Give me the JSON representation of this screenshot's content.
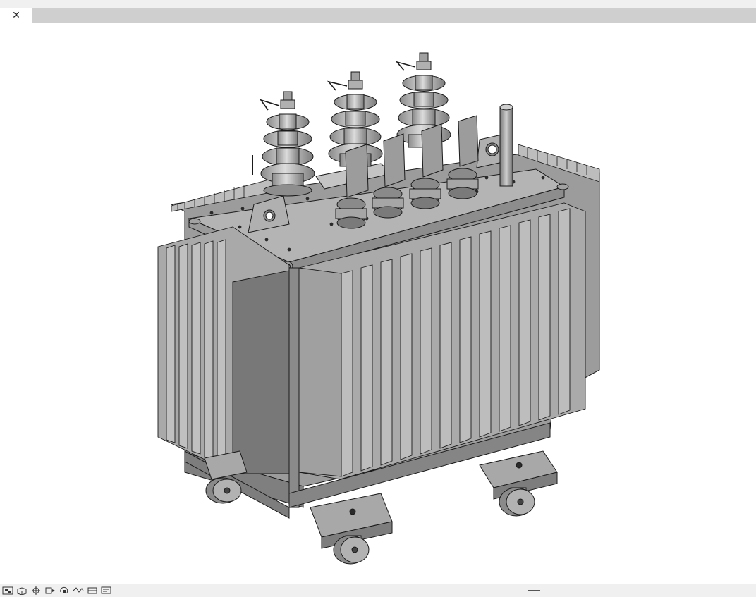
{
  "window": {
    "tab": {
      "close_glyph": "✕"
    }
  },
  "model": {
    "name": "oil-immersed-transformer",
    "colors": {
      "body": "#9a9a9a",
      "fins": "#a8a8a8",
      "dark": "#6f6f6f",
      "outline": "#1a1a1a",
      "bushing": "#b9b9b9"
    }
  },
  "statusbar": {
    "icons": [
      "view-cube-icon",
      "box-view-icon",
      "zoom-icon",
      "pan-icon",
      "rotate-icon",
      "walk-icon",
      "section-icon",
      "display-icon"
    ]
  }
}
